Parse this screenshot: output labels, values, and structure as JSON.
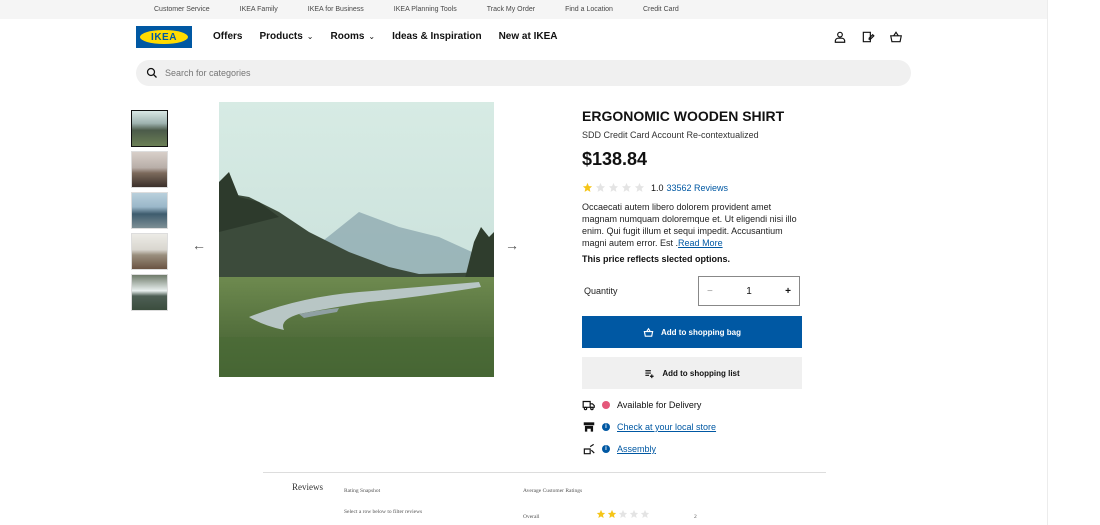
{
  "topbar": {
    "links": [
      "Customer Service",
      "IKEA Family",
      "IKEA for Business",
      "IKEA Planning Tools",
      "Track My Order",
      "Find a Location",
      "Credit Card"
    ]
  },
  "nav": {
    "logo_text": "IKEA",
    "items": [
      "Offers",
      "Products",
      "Rooms",
      "Ideas & Inspiration",
      "New at IKEA"
    ]
  },
  "search": {
    "placeholder": "Search for categories"
  },
  "product": {
    "title": "ERGONOMIC WOODEN SHIRT",
    "subtitle": "SDD Credit Card Account Re-contextualized",
    "price": "$138.84",
    "rating_value": "1.0",
    "rating_fraction": 0.2,
    "reviews_link": "33562 Reviews",
    "description": "Occaecati autem libero dolorem provident amet magnam numquam doloremque et. Ut eligendi nisi illo enim. Qui fugit illum et sequi impedit. Accusantium magni autem error. Est .",
    "read_more": "Read More",
    "price_note": "This price reflects slected options."
  },
  "quantity": {
    "label": "Quantity",
    "value": "1",
    "minus": "−",
    "plus": "+"
  },
  "actions": {
    "add_to_bag": "Add to shopping bag",
    "add_to_list": "Add to shopping list"
  },
  "availability": {
    "delivery": "Available for Delivery",
    "store_link": "Check at your local store",
    "assembly_link": "Assembly"
  },
  "reviews": {
    "title": "Reviews",
    "snapshot": "Rating Snapshot",
    "filter_hint": "Select a row below to filter reviews",
    "average": "Average Customer Ratings",
    "overall_label": "Overall",
    "overall_value": "2"
  },
  "colors": {
    "brand_blue": "#0058a3",
    "brand_yellow": "#ffdb00",
    "star_gold": "#f5c518",
    "delivery_dot": "#e4587a"
  }
}
